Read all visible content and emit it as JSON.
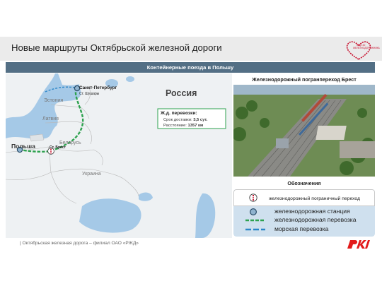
{
  "header": {
    "title": "Новые маршруты Октябрьской железной дороги",
    "logo_text": "ГОД 100 ЖЕЛЕЗНОДОРОЖНИКА"
  },
  "banner": {
    "text": "Контейнерные поезда в Польшу"
  },
  "map": {
    "labels": {
      "russia": "Россия",
      "estonia": "Эстония",
      "latvia": "Латвия",
      "belarus": "Беларусь",
      "ukraine": "Украина",
      "poland": "Польша",
      "spb": "Санкт-Петербург",
      "shushary": "Ст. Шушары",
      "brest": "Ст. Брест"
    },
    "info": {
      "heading": "Ж.д. перевозки:",
      "delivery_label": "Срок доставки:",
      "delivery_value": "3,5 сут.",
      "distance_label": "Расстояние:",
      "distance_value": "1357 км"
    }
  },
  "photo": {
    "title": "Железнодорожный погранпереход Брест"
  },
  "legend": {
    "title": "Обозначения",
    "items": [
      {
        "symbol": "border-crossing-icon",
        "label": "железнодорожный пограничный переход"
      },
      {
        "symbol": "station-icon",
        "label": "железнодорожная станция"
      },
      {
        "symbol": "rail-line",
        "label": "железнодорожная перевозка"
      },
      {
        "symbol": "sea-line",
        "label": "морская перевозка"
      }
    ]
  },
  "footer": {
    "text": "| Октябрьская железная дорога – филиал ОАО «РЖД»",
    "logo": "РЖД"
  },
  "colors": {
    "brand_red": "#e21a1a",
    "banner": "#536f85",
    "rail_green": "#2ea24f",
    "sea_blue": "#2b86c8",
    "land": "#eef1f3",
    "water": "#a5c9e7"
  }
}
